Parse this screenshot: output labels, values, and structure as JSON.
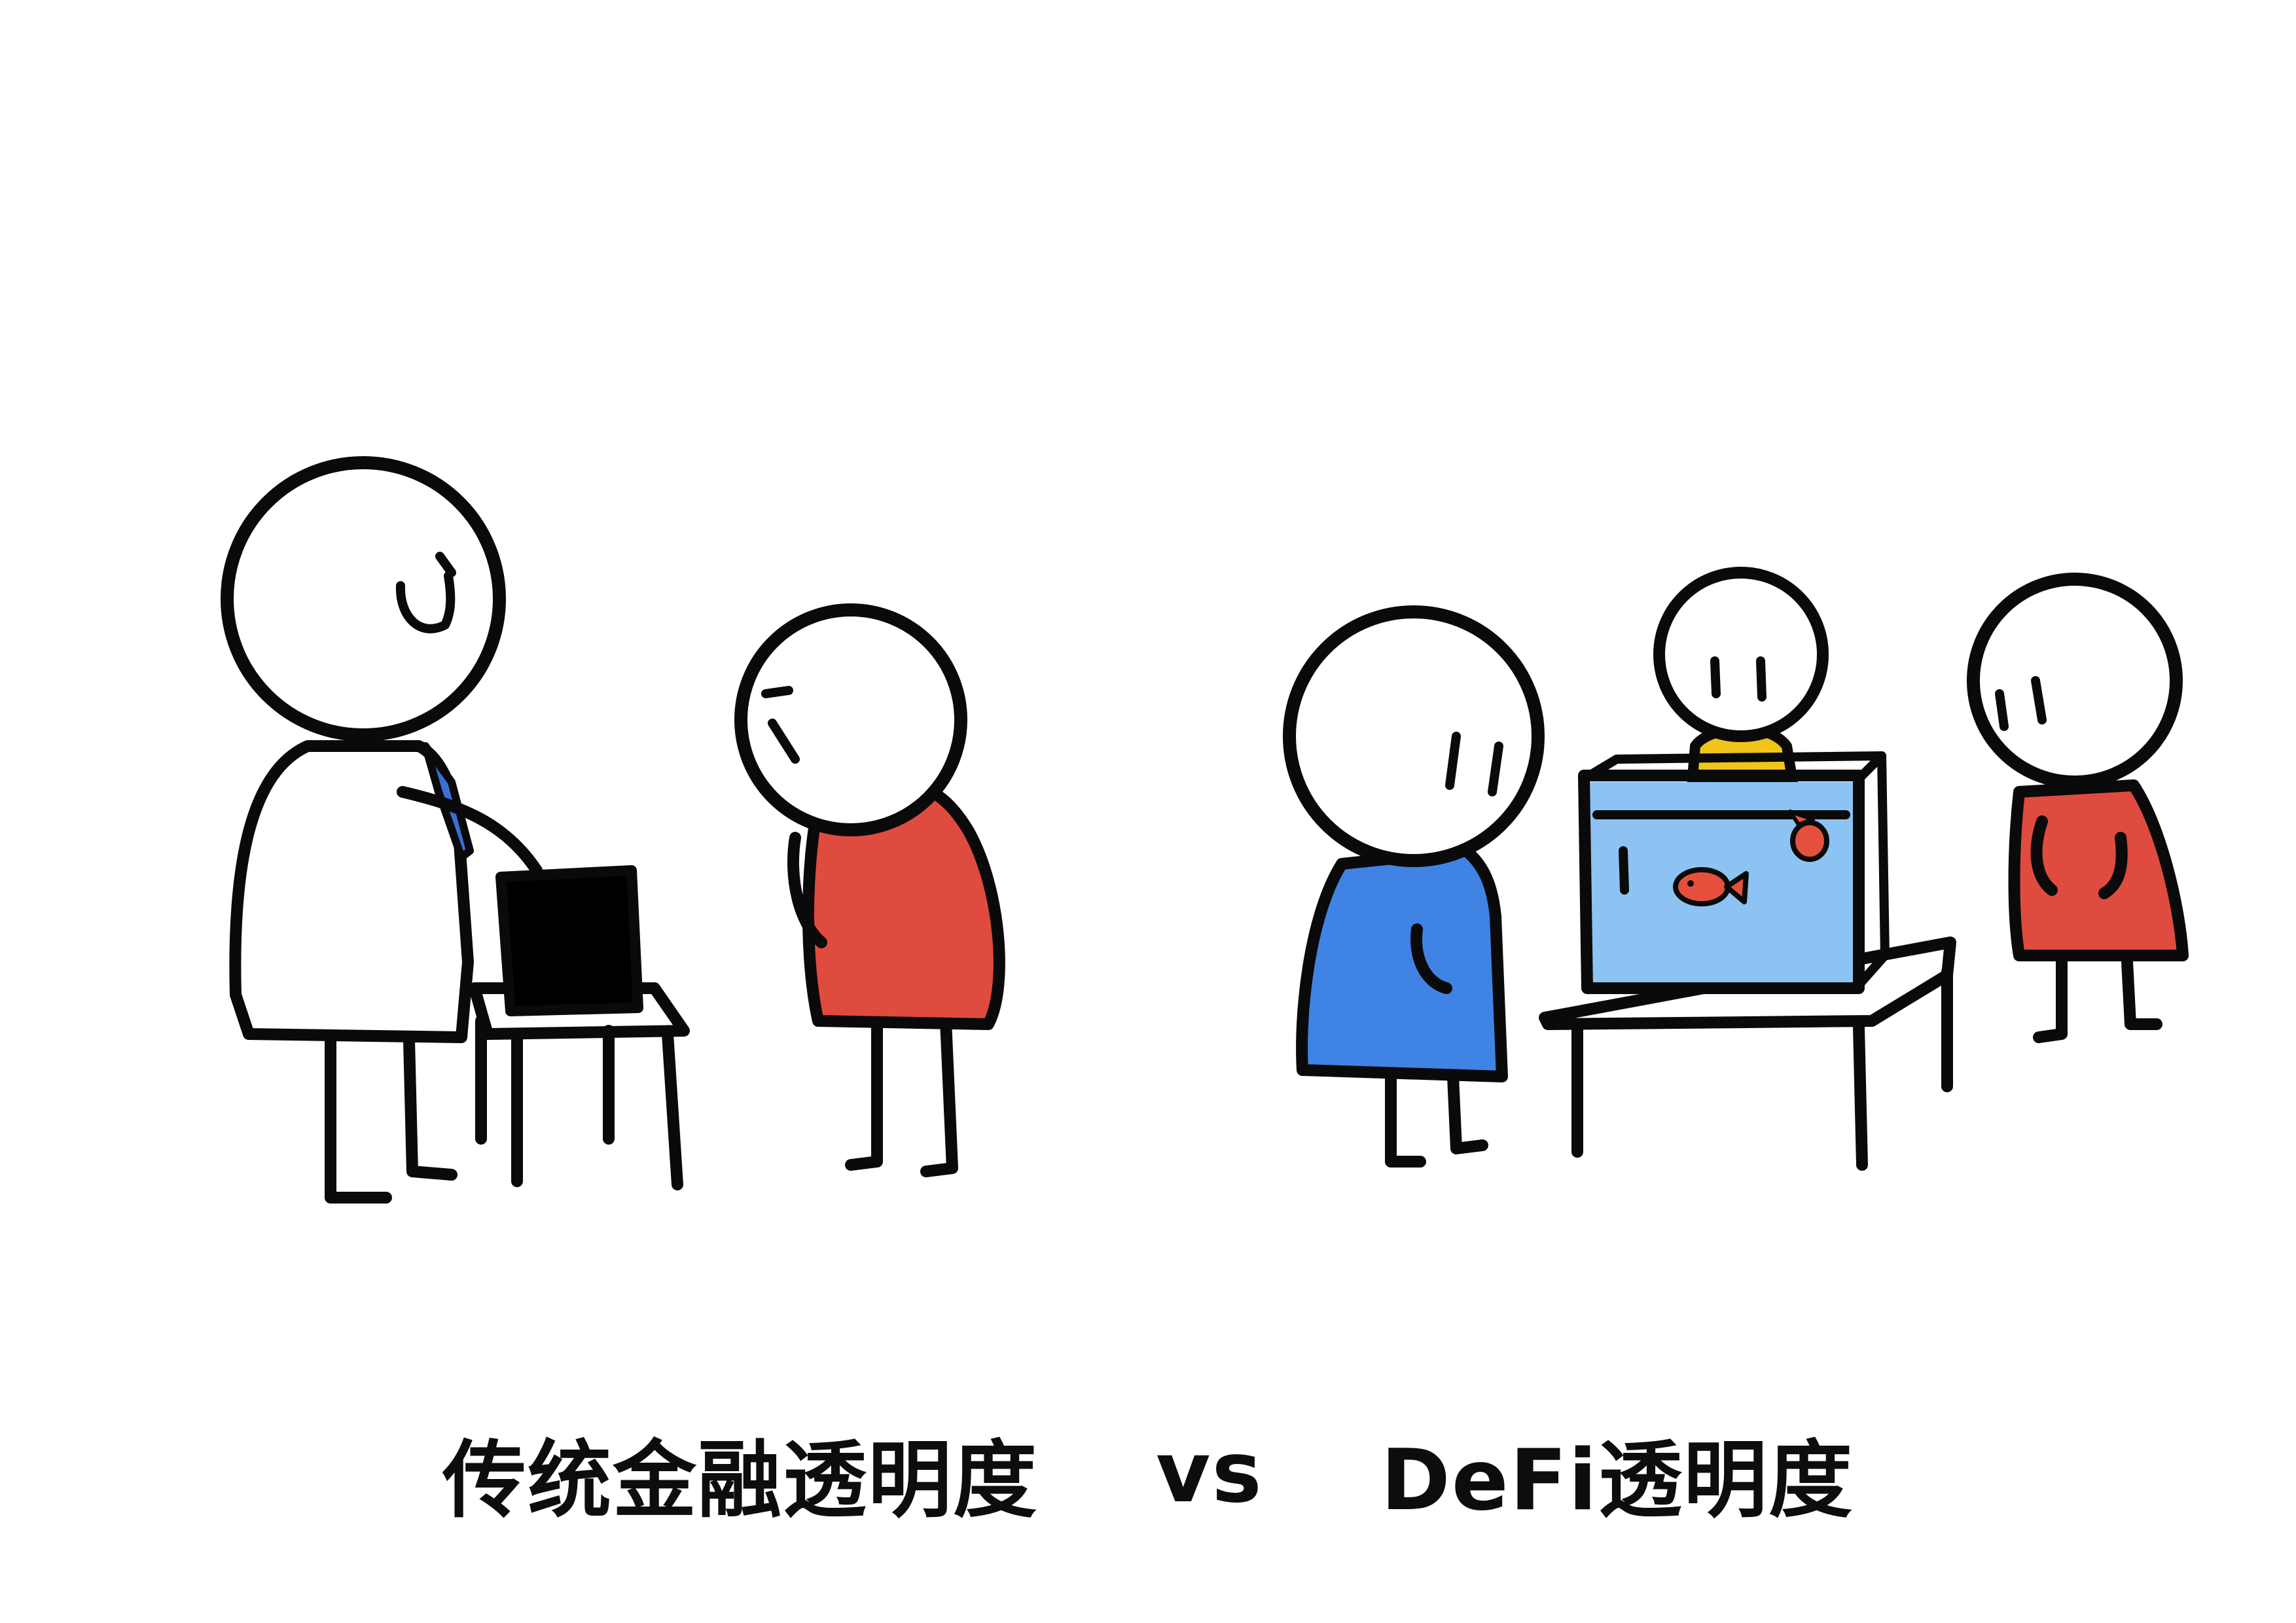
{
  "caption": {
    "left": "传统金融透明度",
    "vs": "vs",
    "right": "DeFi透明度"
  },
  "colors": {
    "ink": "#0a0a0a",
    "red_shirt": "#e04b3f",
    "blue_shirt": "#3f84e5",
    "yellow_shirt": "#f0c419",
    "tank_water": "#8dc3f2",
    "fish": "#e5503d",
    "briefcase": "#000000",
    "tie": "#3a6fd8"
  },
  "icons": {
    "left_scene": [
      "banker-figure",
      "client-figure",
      "opaque-black-box",
      "table"
    ],
    "right_scene": [
      "blue-figure",
      "yellow-figure",
      "red-figure",
      "fish-tank",
      "table"
    ]
  }
}
